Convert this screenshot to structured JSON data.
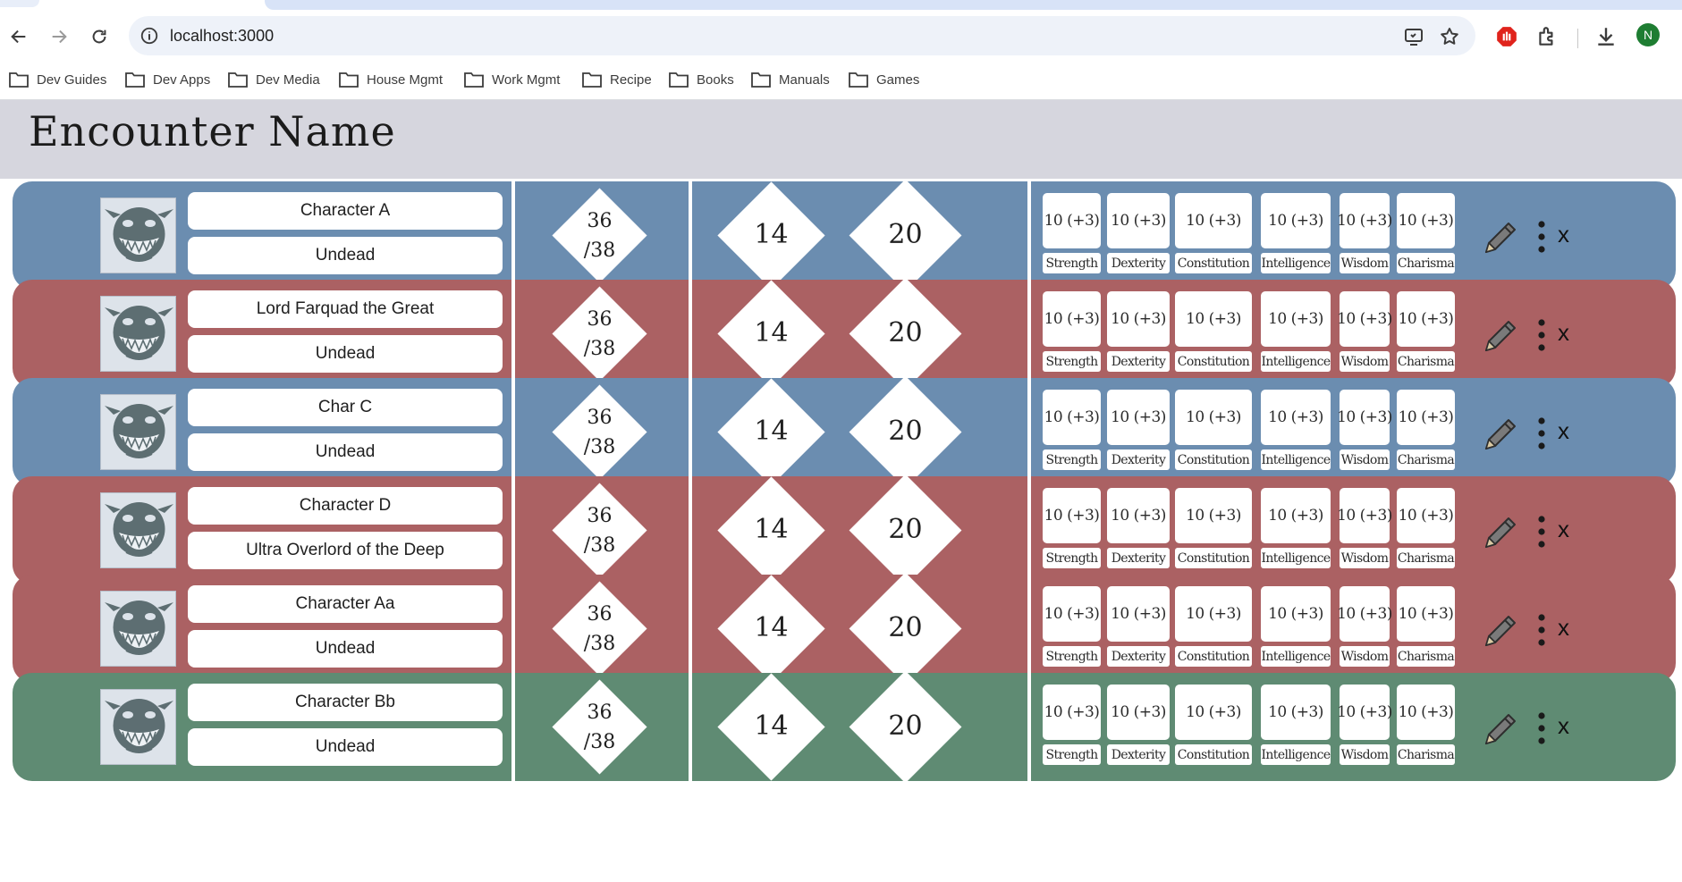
{
  "browser": {
    "url": "localhost:3000",
    "profile_initial": "N",
    "bookmarks": [
      "Dev Guides",
      "Dev Apps",
      "Dev Media",
      "House Mgmt",
      "Work Mgmt",
      "Recipe",
      "Books",
      "Manuals",
      "Games"
    ]
  },
  "page": {
    "title": "Encounter Name"
  },
  "stat_labels": [
    "Strength",
    "Dexterity",
    "Constitution",
    "Intelligence",
    "Wisdom",
    "Charisma"
  ],
  "colors": {
    "blue": "#6b8db0",
    "red": "#ab6163",
    "green": "#5f8b73"
  },
  "combatants": [
    {
      "name": "Character A",
      "type": "Undead",
      "hp_current": "36",
      "hp_max": "/38",
      "ac": "14",
      "initiative": "20",
      "stats": [
        "10 (+3)",
        "10 (+3)",
        "10 (+3)",
        "10 (+3)",
        "10 (+3)",
        "10 (+3)"
      ],
      "color": "blue"
    },
    {
      "name": "Lord Farquad the Great",
      "type": "Undead",
      "hp_current": "36",
      "hp_max": "/38",
      "ac": "14",
      "initiative": "20",
      "stats": [
        "10 (+3)",
        "10 (+3)",
        "10 (+3)",
        "10 (+3)",
        "10 (+3)",
        "10 (+3)"
      ],
      "color": "red"
    },
    {
      "name": "Char C",
      "type": "Undead",
      "hp_current": "36",
      "hp_max": "/38",
      "ac": "14",
      "initiative": "20",
      "stats": [
        "10 (+3)",
        "10 (+3)",
        "10 (+3)",
        "10 (+3)",
        "10 (+3)",
        "10 (+3)"
      ],
      "color": "blue"
    },
    {
      "name": "Character D",
      "type": "Ultra Overlord of the Deep",
      "hp_current": "36",
      "hp_max": "/38",
      "ac": "14",
      "initiative": "20",
      "stats": [
        "10 (+3)",
        "10 (+3)",
        "10 (+3)",
        "10 (+3)",
        "10 (+3)",
        "10 (+3)"
      ],
      "color": "red"
    },
    {
      "name": "Character Aa",
      "type": "Undead",
      "hp_current": "36",
      "hp_max": "/38",
      "ac": "14",
      "initiative": "20",
      "stats": [
        "10 (+3)",
        "10 (+3)",
        "10 (+3)",
        "10 (+3)",
        "10 (+3)",
        "10 (+3)"
      ],
      "color": "red"
    },
    {
      "name": "Character Bb",
      "type": "Undead",
      "hp_current": "36",
      "hp_max": "/38",
      "ac": "14",
      "initiative": "20",
      "stats": [
        "10 (+3)",
        "10 (+3)",
        "10 (+3)",
        "10 (+3)",
        "10 (+3)",
        "10 (+3)"
      ],
      "color": "green"
    }
  ],
  "row_actions": {
    "edit_label": "edit",
    "menu_label": "more",
    "delete_label": "x"
  }
}
